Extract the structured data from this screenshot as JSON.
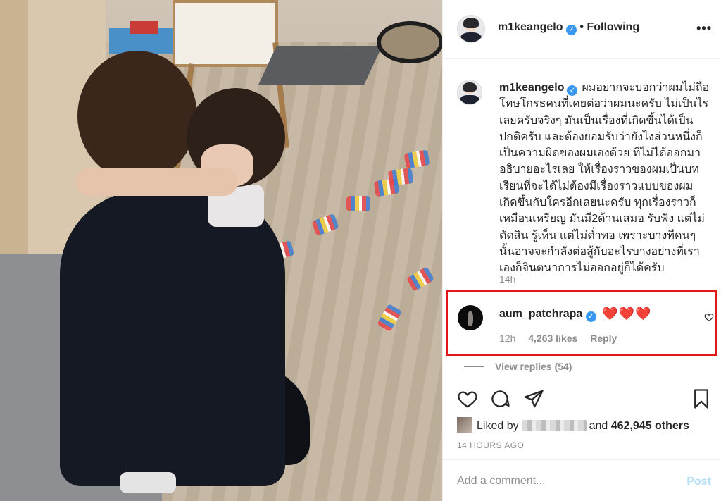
{
  "header": {
    "username": "m1keangelo",
    "separator": "•",
    "follow_status": "Following",
    "more_icon": "more-horizontal-icon"
  },
  "caption": {
    "username": "m1keangelo",
    "text": "ผมอยากจะบอกว่าผมไม่ถือโทษโกรธคนที่เคยต่อว่าผมนะครับ ไม่เป็นไรเลยครับจริงๆ มันเป็นเรื่องที่เกิดขึ้นได้เป็นปกติครับ และต้องยอมรับว่ายังไงส่วนหนึ่งก็เป็นความผิดของผมเองด้วย ที่ไม่ได้ออกมาอธิบายอะไรเลย ให้เรื่องราวของผมเป็นบทเรียนที่จะได้ไม่ต้องมีเรื่องราวแบบของผมเกิดขึ้นกับใครอีกเลยนะครับ ทุกเรื่องราวก็เหมือนเหรียญ มันมี2ด้านเสมอ รับฟัง แต่ไม่ตัดสิน รู้เห็น แต่ไม่ต่ำทอ เพราะบางทีคนๆนั้นอาจจะกำลังต่อสู้กับอะไรบางอย่างที่เราเองก็จินตนาการไม่ออกอยู่ก็ได้ครับ",
    "time": "14h"
  },
  "comment": {
    "username": "aum_patchrapa",
    "text": "❤️❤️❤️",
    "time": "12h",
    "likes": "4,263 likes",
    "reply": "Reply",
    "view_replies": "View replies (54)"
  },
  "actions": {
    "like_icon": "heart-icon",
    "comment_icon": "comment-icon",
    "share_icon": "send-icon",
    "save_icon": "bookmark-icon"
  },
  "likes": {
    "prefix": "Liked by",
    "conjunction": "and",
    "others": "462,945 others"
  },
  "posted": "14 HOURS AGO",
  "add_comment": {
    "placeholder": "Add a comment...",
    "post_label": "Post"
  },
  "colors": {
    "verified": "#3897f0",
    "highlight_border": "#e21818",
    "post_disabled": "#b2dffc",
    "meta_gray": "#8e8e8e"
  }
}
